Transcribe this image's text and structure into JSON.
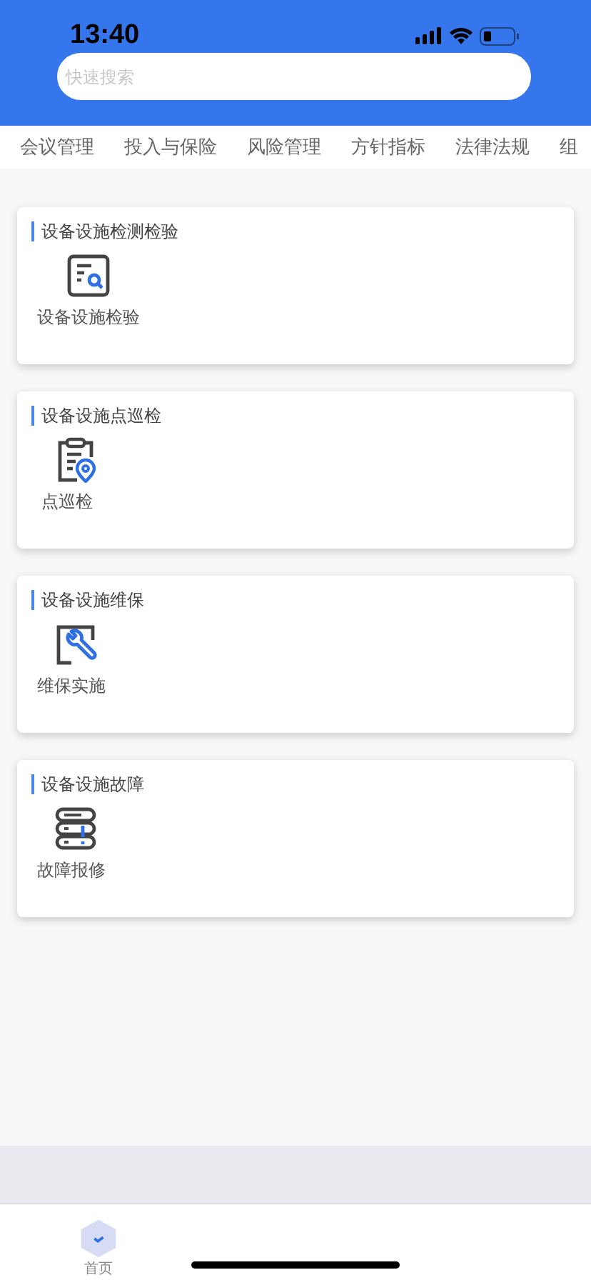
{
  "status_bar": {
    "time": "13:40"
  },
  "search": {
    "placeholder": "快速搜索"
  },
  "categories": [
    "会议管理",
    "投入与保险",
    "风险管理",
    "方针指标",
    "法律法规",
    "组"
  ],
  "sections": [
    {
      "title": "设备设施检测检验",
      "items": [
        {
          "label": "设备设施检验",
          "kind": "inspect"
        }
      ]
    },
    {
      "title": "设备设施点巡检",
      "items": [
        {
          "label": "点巡检",
          "kind": "patrol"
        }
      ]
    },
    {
      "title": "设备设施维保",
      "items": [
        {
          "label": "维保实施",
          "kind": "maintain"
        }
      ]
    },
    {
      "title": "设备设施故障",
      "items": [
        {
          "label": "故障报修",
          "kind": "fault"
        }
      ]
    }
  ],
  "tab_bar": [
    {
      "label": "首页"
    }
  ]
}
